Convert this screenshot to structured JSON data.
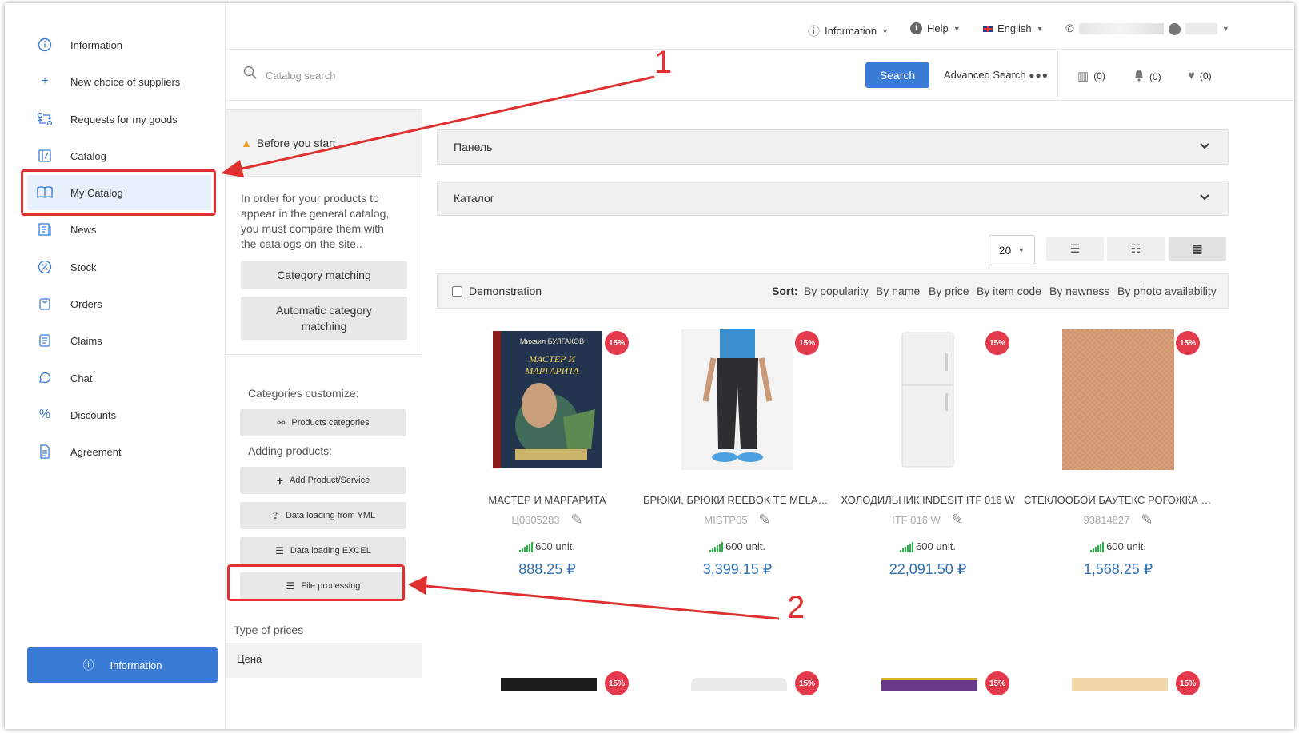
{
  "sidebar": {
    "items": [
      {
        "label": "Information",
        "icon": "info-icon"
      },
      {
        "label": "New choice of suppliers",
        "icon": "plus-icon"
      },
      {
        "label": "Requests for my goods",
        "icon": "exchange-icon"
      },
      {
        "label": "Catalog",
        "icon": "catalog-icon"
      },
      {
        "label": "My Catalog",
        "icon": "book-icon"
      },
      {
        "label": "News",
        "icon": "news-icon"
      },
      {
        "label": "Stock",
        "icon": "stock-icon"
      },
      {
        "label": "Orders",
        "icon": "orders-icon"
      },
      {
        "label": "Claims",
        "icon": "claims-icon"
      },
      {
        "label": "Chat",
        "icon": "chat-icon"
      },
      {
        "label": "Discounts",
        "icon": "percent-icon"
      },
      {
        "label": "Agreement",
        "icon": "document-icon"
      }
    ],
    "bottom_button": "Information"
  },
  "topbar": {
    "information": "Information",
    "help": "Help",
    "language": "English"
  },
  "search": {
    "placeholder": "Catalog search",
    "button": "Search",
    "advanced": "Advanced Search"
  },
  "counters": {
    "compare": "(0)",
    "notifications": "(0)",
    "favorites": "(0)"
  },
  "before": {
    "title": "Before you start",
    "text": "In order for your products to appear in the general catalog, you must compare them with the catalogs on the site..",
    "category_matching": "Category matching",
    "automatic_matching": "Automatic category matching"
  },
  "customize": {
    "label": "Categories customize:",
    "products_categories": "Products categories"
  },
  "adding": {
    "label": "Adding products:",
    "add_product": "Add Product/Service",
    "yml": "Data loading from YML",
    "excel": "Data loading EXCEL",
    "file_processing": "File processing"
  },
  "prices": {
    "label": "Type of prices",
    "value": "Цена"
  },
  "accordions": {
    "panel": "Панель",
    "catalog": "Каталог"
  },
  "per_page": "20",
  "sortbar": {
    "demonstration": "Demonstration",
    "sort_label": "Sort:",
    "options": [
      "By popularity",
      "By name",
      "By price",
      "By item code",
      "By newness",
      "By photo availability"
    ]
  },
  "products": [
    {
      "name": "МАСТЕР И МАРГАРИТА",
      "code": "Ц0005283",
      "stock": "600 unit.",
      "price": "888.25 ₽",
      "badge": "15%",
      "book_author": "Михаил БУЛГАКОВ",
      "book_title": "МАСТЕР И МАРГАРИТА"
    },
    {
      "name": "БРЮКИ, БРЮКИ REEBOK TE MELANGE JOGGER",
      "code": "MISTP05",
      "stock": "600 unit.",
      "price": "3,399.15 ₽",
      "badge": "15%"
    },
    {
      "name": "ХОЛОДИЛЬНИК INDESIT ITF 016 W",
      "code": "ITF 016 W",
      "stock": "600 unit.",
      "price": "22,091.50 ₽",
      "badge": "15%"
    },
    {
      "name": "СТЕКЛООБОИ БАУТЕКС РОГОЖКА СРЕДНЯЯ",
      "code": "93814827",
      "stock": "600 unit.",
      "price": "1,568.25 ₽",
      "badge": "15%"
    }
  ],
  "row2_badges": [
    "15%",
    "15%",
    "15%",
    "15%"
  ],
  "annotations": {
    "one": "1",
    "two": "2"
  },
  "colors": {
    "accent": "#3a7bd5",
    "badge": "#e33b4b",
    "price": "#2f6fb3",
    "annotation": "#e03131",
    "stock_bars": "#2db34a"
  }
}
